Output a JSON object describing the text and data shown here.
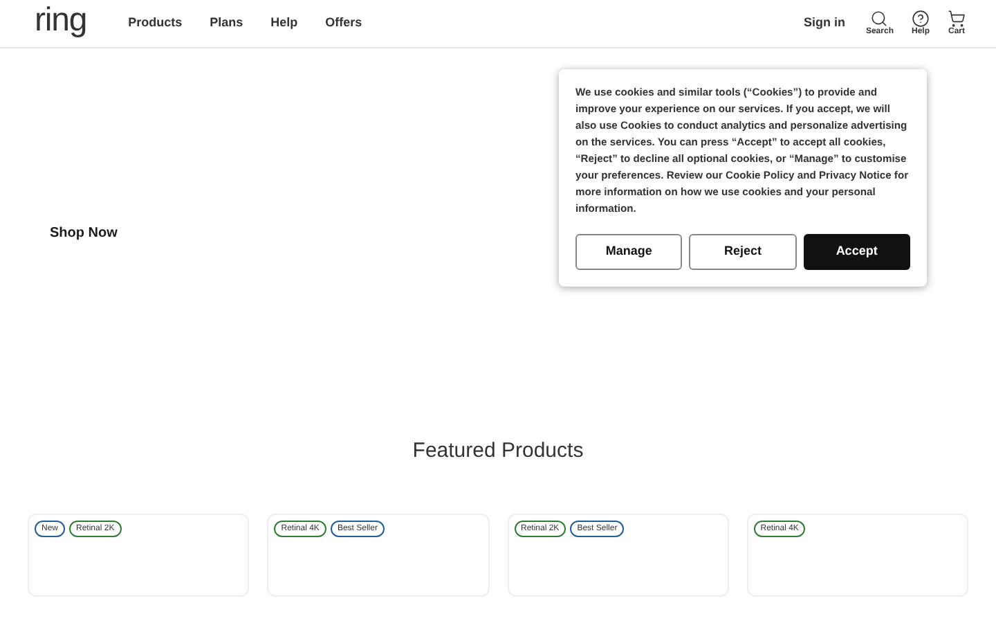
{
  "header": {
    "logo": "ring",
    "nav": [
      "Products",
      "Plans",
      "Help",
      "Offers"
    ],
    "sign_in": "Sign in",
    "icons": [
      {
        "kind": "search",
        "label": "Search"
      },
      {
        "kind": "help",
        "label": "Help"
      },
      {
        "kind": "cart",
        "label": "Cart"
      }
    ]
  },
  "hero": {
    "link": "Shop Now"
  },
  "cookie_dialog": {
    "text": "We use cookies and similar tools (“Cookies”) to provide and improve your experience on our services. If you accept, we will also use Cookies to conduct analytics and personalize advertising on the services. You can press “Accept” to accept all cookies, “Reject” to decline all optional cookies, or “Manage” to customise your preferences. Review our Cookie Policy and Privacy Notice for more information on how we use cookies and your personal information.",
    "buttons": [
      {
        "label": "Manage",
        "kind": "outline"
      },
      {
        "label": "Reject",
        "kind": "outline"
      },
      {
        "label": "Accept",
        "kind": "solid"
      }
    ]
  },
  "featured": {
    "title": "Featured Products",
    "cards": [
      {
        "badges": [
          {
            "label": "New",
            "color": "#1f5f9e"
          },
          {
            "label": "Retinal 2K",
            "color": "#2e7d32"
          }
        ]
      },
      {
        "badges": [
          {
            "label": "Retinal 4K",
            "color": "#2e7d32"
          },
          {
            "label": "Best Seller",
            "color": "#1f5f9e"
          }
        ]
      },
      {
        "badges": [
          {
            "label": "Retinal 2K",
            "color": "#2e7d32"
          },
          {
            "label": "Best Seller",
            "color": "#1f5f9e"
          }
        ]
      },
      {
        "badges": [
          {
            "label": "Retinal 4K",
            "color": "#2e7d32"
          }
        ]
      }
    ]
  }
}
